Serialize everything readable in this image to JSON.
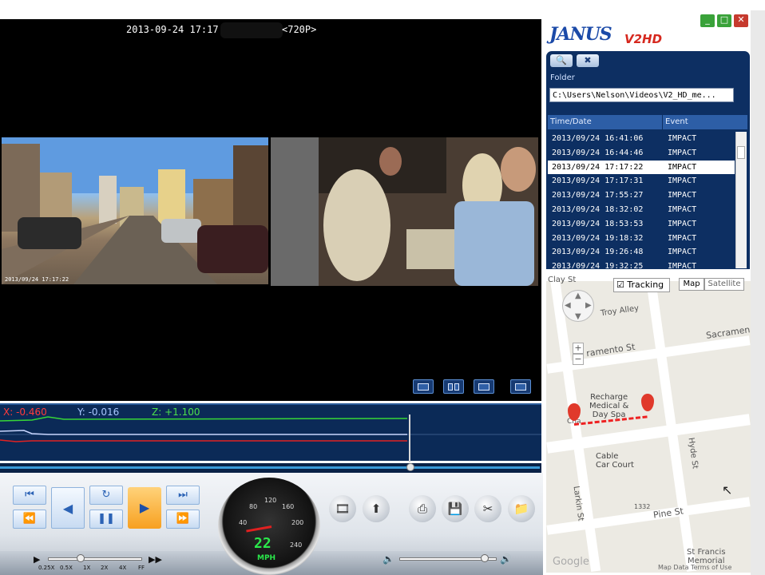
{
  "video": {
    "timestamp": "2013-09-24 17:17:2",
    "resolution": "<720P>",
    "cam1_overlay": "2013/09/24 17:17:22"
  },
  "view_buttons": [
    "single-view-icon",
    "dual-view-icon",
    "pip-view-icon",
    "fullscreen-icon"
  ],
  "accel": {
    "x": "X: -0.460",
    "y": "Y: -0.016",
    "z": "Z: +1.100"
  },
  "playback": {
    "buttons": {
      "first": "⏮",
      "repeat": "↻",
      "last": "⏭",
      "rewind": "⏪",
      "prev_frame": "◀",
      "play": "▶",
      "pause": "❚❚",
      "fast_forward": "⏩"
    },
    "speed_labels": [
      "0.25X",
      "0.5X",
      "1X",
      "2X",
      "4X",
      "FF"
    ],
    "speed_value": 0.35,
    "volume_value": 0.88
  },
  "gauge": {
    "speed": "22",
    "unit": "MPH",
    "ticks": [
      "40",
      "80",
      "120",
      "160",
      "200",
      "240"
    ]
  },
  "tools": [
    "video-clip-icon",
    "upload-icon",
    "print-icon",
    "save-icon",
    "settings-tools-icon",
    "folder-icon"
  ],
  "brand": {
    "name": "JANUS",
    "model": "V2HD"
  },
  "window_buttons": {
    "minimize": "_",
    "maximize": "□",
    "close": "✕"
  },
  "panel": {
    "folder_label": "Folder",
    "folder_path": "C:\\Users\\Nelson\\Videos\\V2_HD_me...",
    "columns": [
      "Time/Date",
      "Event"
    ],
    "events": [
      {
        "date": "2013/09/24 16:41:06",
        "event": "IMPACT"
      },
      {
        "date": "2013/09/24 16:44:46",
        "event": "IMPACT"
      },
      {
        "date": "2013/09/24 17:17:22",
        "event": "IMPACT",
        "selected": true
      },
      {
        "date": "2013/09/24 17:17:31",
        "event": "IMPACT"
      },
      {
        "date": "2013/09/24 17:55:27",
        "event": "IMPACT"
      },
      {
        "date": "2013/09/24 18:32:02",
        "event": "IMPACT"
      },
      {
        "date": "2013/09/24 18:53:53",
        "event": "IMPACT"
      },
      {
        "date": "2013/09/24 19:18:32",
        "event": "IMPACT"
      },
      {
        "date": "2013/09/24 19:26:48",
        "event": "IMPACT"
      },
      {
        "date": "2013/09/24 19:32:25",
        "event": "IMPACT"
      }
    ]
  },
  "map": {
    "tracking_label": "Tracking",
    "map_btn": "Map",
    "satellite_btn": "Satellite",
    "labels": {
      "clay": "Clay St",
      "troy": "Troy Alley",
      "sacramento_left": "ramento St",
      "sacramento_right": "Sacramen",
      "recharge": "Recharge\nMedical &\nDay Spa",
      "cable": "Cable\nCar Court",
      "hyde": "Hyde St",
      "larkin": "Larkin St",
      "pine": "Pine St",
      "stfrancis": "St Francis\nMemorial",
      "num1332": "1332",
      "cha": "Cha",
      "google": "Google",
      "terms": "Map Data  Terms of Use"
    }
  }
}
